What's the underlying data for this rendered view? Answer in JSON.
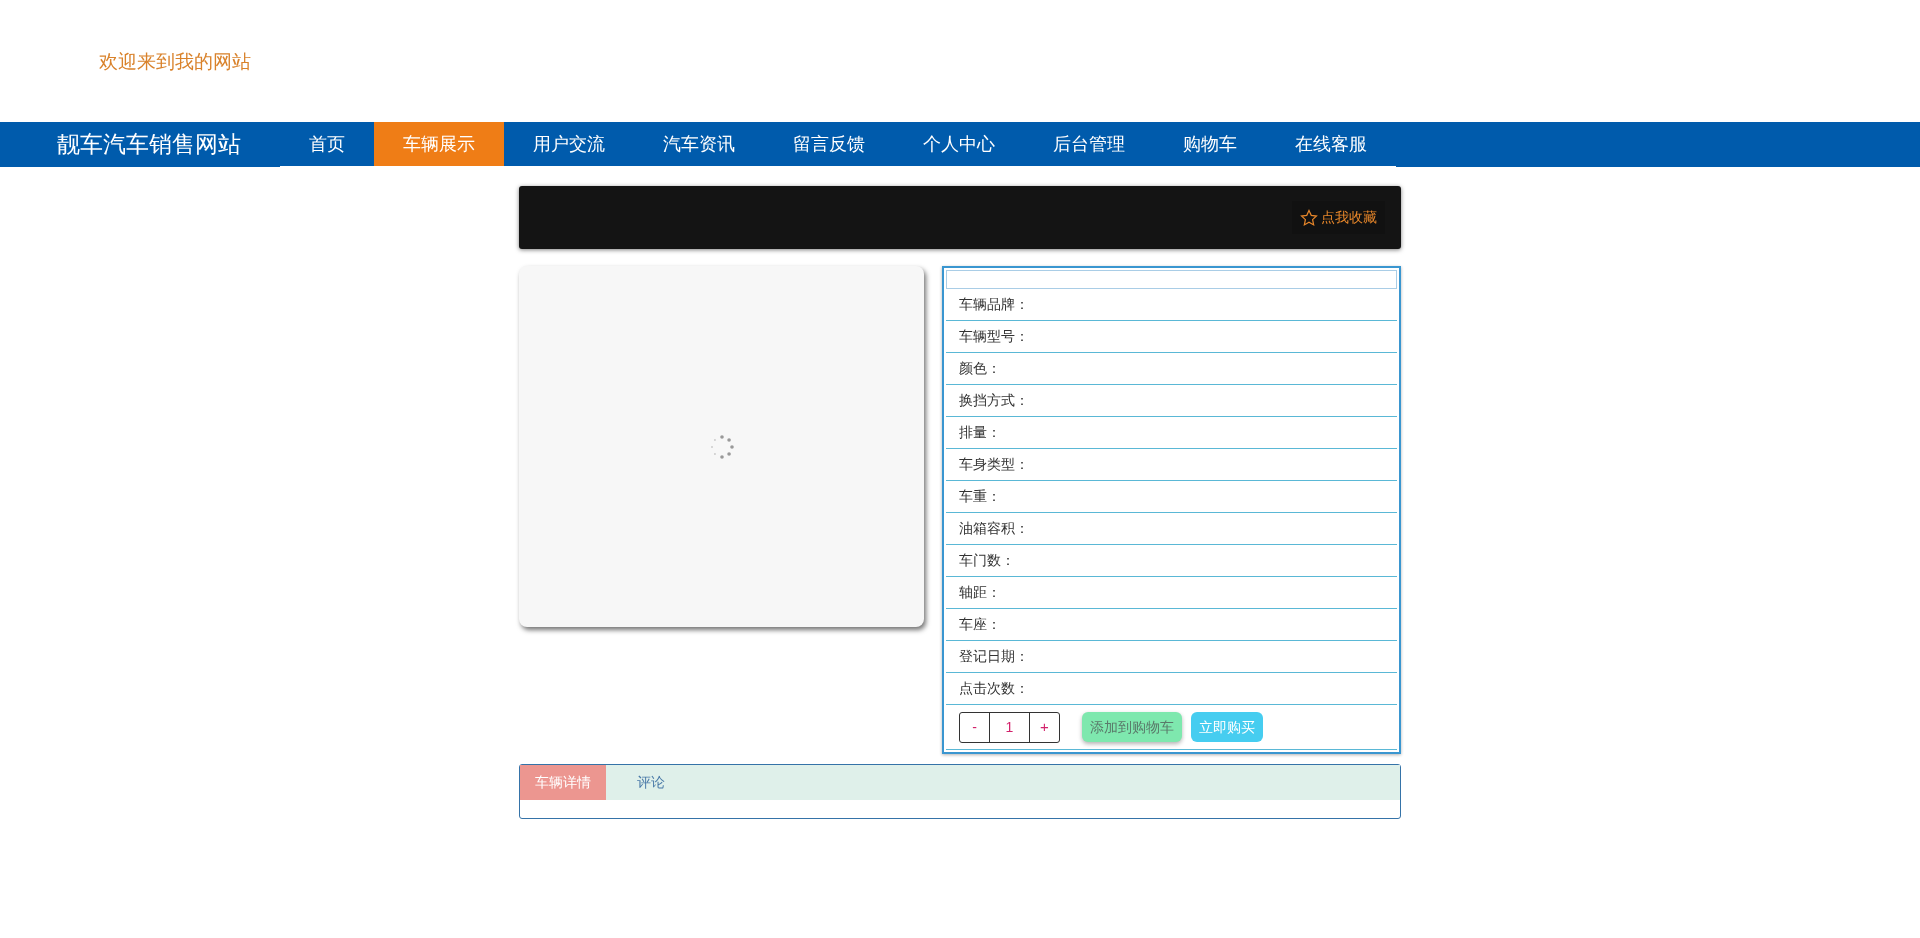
{
  "header": {
    "welcome": "欢迎来到我的网站"
  },
  "nav": {
    "brand": "靓车汽车销售网站",
    "items": [
      {
        "label": "首页",
        "selected": false
      },
      {
        "label": "车辆展示",
        "selected": true
      },
      {
        "label": "用户交流",
        "selected": false
      },
      {
        "label": "汽车资讯",
        "selected": false
      },
      {
        "label": "留言反馈",
        "selected": false
      },
      {
        "label": "个人中心",
        "selected": false
      },
      {
        "label": "后台管理",
        "selected": false
      },
      {
        "label": "购物车",
        "selected": false
      },
      {
        "label": "在线客服",
        "selected": false
      }
    ]
  },
  "title_bar": {
    "favorite": "点我收藏"
  },
  "image": {
    "kind": "loading"
  },
  "details": {
    "fields": [
      "车辆品牌：",
      "车辆型号：",
      "颜色：",
      "换挡方式：",
      "排量：",
      "车身类型：",
      "车重：",
      "油箱容积：",
      "车门数：",
      "轴距：",
      "车座：",
      "登记日期：",
      "点击次数："
    ],
    "quantity": {
      "minus": "-",
      "value": "1",
      "plus": "+"
    },
    "buttons": [
      {
        "label": "添加到购物车",
        "kind": "cart"
      },
      {
        "label": "立即购买",
        "kind": "buy"
      }
    ]
  },
  "tabs": [
    {
      "label": "车辆详情",
      "selected": true
    },
    {
      "label": "评论",
      "selected": false
    }
  ]
}
